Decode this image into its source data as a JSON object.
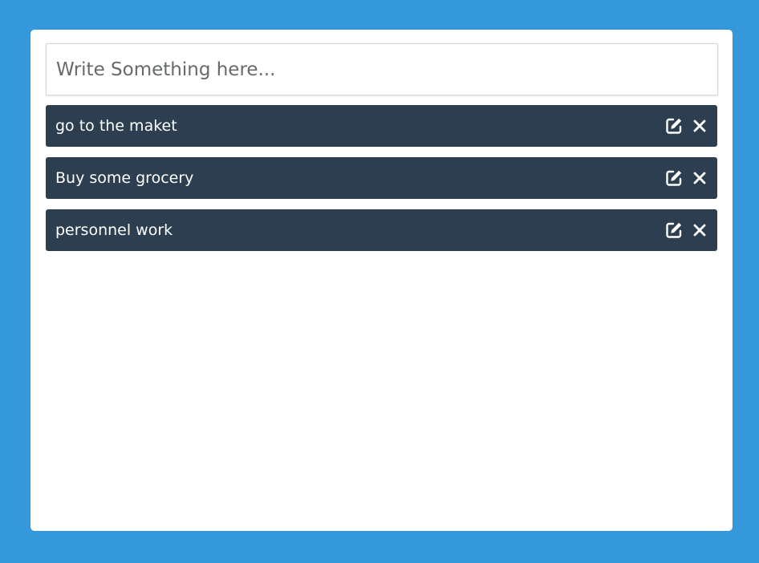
{
  "input": {
    "placeholder": "Write Something here...",
    "value": ""
  },
  "todos": [
    {
      "text": "go to the maket"
    },
    {
      "text": "Buy some grocery"
    },
    {
      "text": "personnel work"
    }
  ],
  "icons": {
    "edit": "edit-icon",
    "delete": "close-icon"
  },
  "colors": {
    "background": "#3498db",
    "card": "#ffffff",
    "item": "#2c3e50",
    "item_text": "#ffffff"
  }
}
